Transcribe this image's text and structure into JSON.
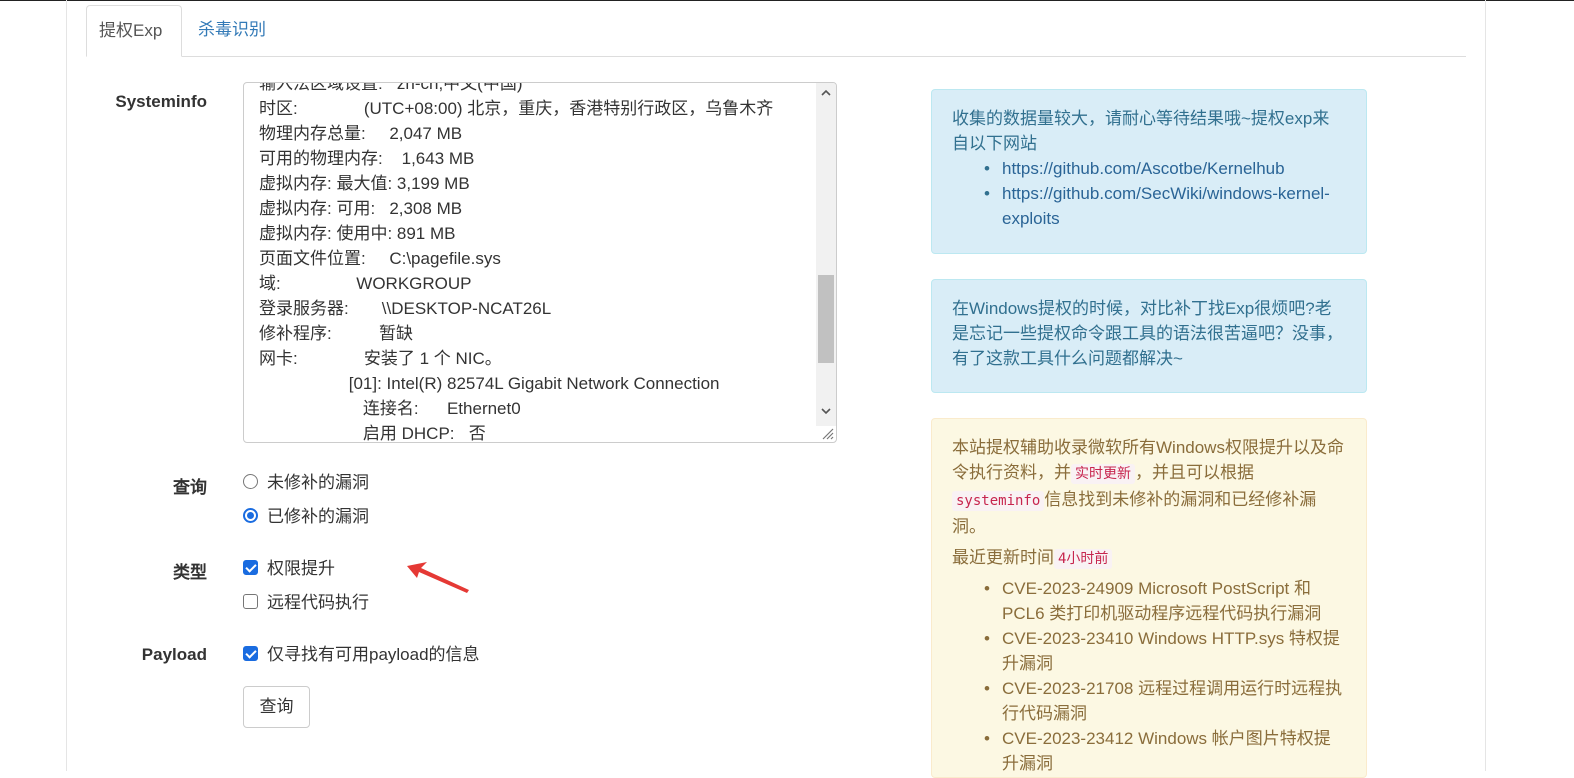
{
  "tabs": [
    {
      "label": "提权Exp",
      "active": true
    },
    {
      "label": "杀毒识别",
      "active": false
    }
  ],
  "form": {
    "systeminfo_label": "Systeminfo",
    "systeminfo_lines": [
      "输入法区域设置:   zh-cn;中文(中国)",
      "时区:              (UTC+08:00) 北京，重庆，香港特别行政区，乌鲁木齐",
      "物理内存总量:     2,047 MB",
      "可用的物理内存:    1,643 MB",
      "虚拟内存: 最大值: 3,199 MB",
      "虚拟内存: 可用:   2,308 MB",
      "虚拟内存: 使用中: 891 MB",
      "页面文件位置:     C:\\pagefile.sys",
      "域:                WORKGROUP",
      "登录服务器:       \\\\DESKTOP-NCAT26L",
      "修补程序:          暂缺",
      "网卡:              安装了 1 个 NIC。",
      "                   [01]: Intel(R) 82574L Gigabit Network Connection",
      "                      连接名:      Ethernet0",
      "                      启用 DHCP:   否"
    ],
    "query_label": "查询",
    "query_options": [
      {
        "label": "未修补的漏洞",
        "checked": false
      },
      {
        "label": "已修补的漏洞",
        "checked": true
      }
    ],
    "type_label": "类型",
    "type_options": [
      {
        "label": "权限提升",
        "checked": true
      },
      {
        "label": "远程代码执行",
        "checked": false
      }
    ],
    "payload_label": "Payload",
    "payload_option": {
      "label": "仅寻找有可用payload的信息",
      "checked": true
    },
    "submit_label": "查询"
  },
  "info1": {
    "text": "收集的数据量较大，请耐心等待结果哦~提权exp来自以下网站",
    "links": [
      "https://github.com/Ascotbe/Kernelhub",
      "https://github.com/SecWiki/windows-kernel-exploits"
    ]
  },
  "info2": {
    "text": "在Windows提权的时候，对比补丁找Exp很烦吧?老是忘记一些提权命令跟工具的语法很苦逼吧？没事，有了这款工具什么问题都解决~"
  },
  "warn": {
    "text_a": "本站提权辅助收录微软所有Windows权限提升以及命令执行资料，并",
    "code_a": "实时更新",
    "text_b": "，并且可以根据",
    "code_b": "systeminfo",
    "text_c": "信息找到未修补的漏洞和已经修补漏洞。",
    "updated_label": "最近更新时间",
    "updated_value": "4小时前",
    "items": [
      "CVE-2023-24909 Microsoft PostScript 和 PCL6 类打印机驱动程序远程代码执行漏洞",
      "CVE-2023-23410 Windows HTTP.sys 特权提升漏洞",
      "CVE-2023-21708 远程过程调用运行时远程执行代码漏洞",
      "CVE-2023-23412 Windows 帐户图片特权提升漏洞"
    ]
  },
  "colors": {
    "accent": "#1a6ce0",
    "annotation_arrow": "#e53935"
  }
}
